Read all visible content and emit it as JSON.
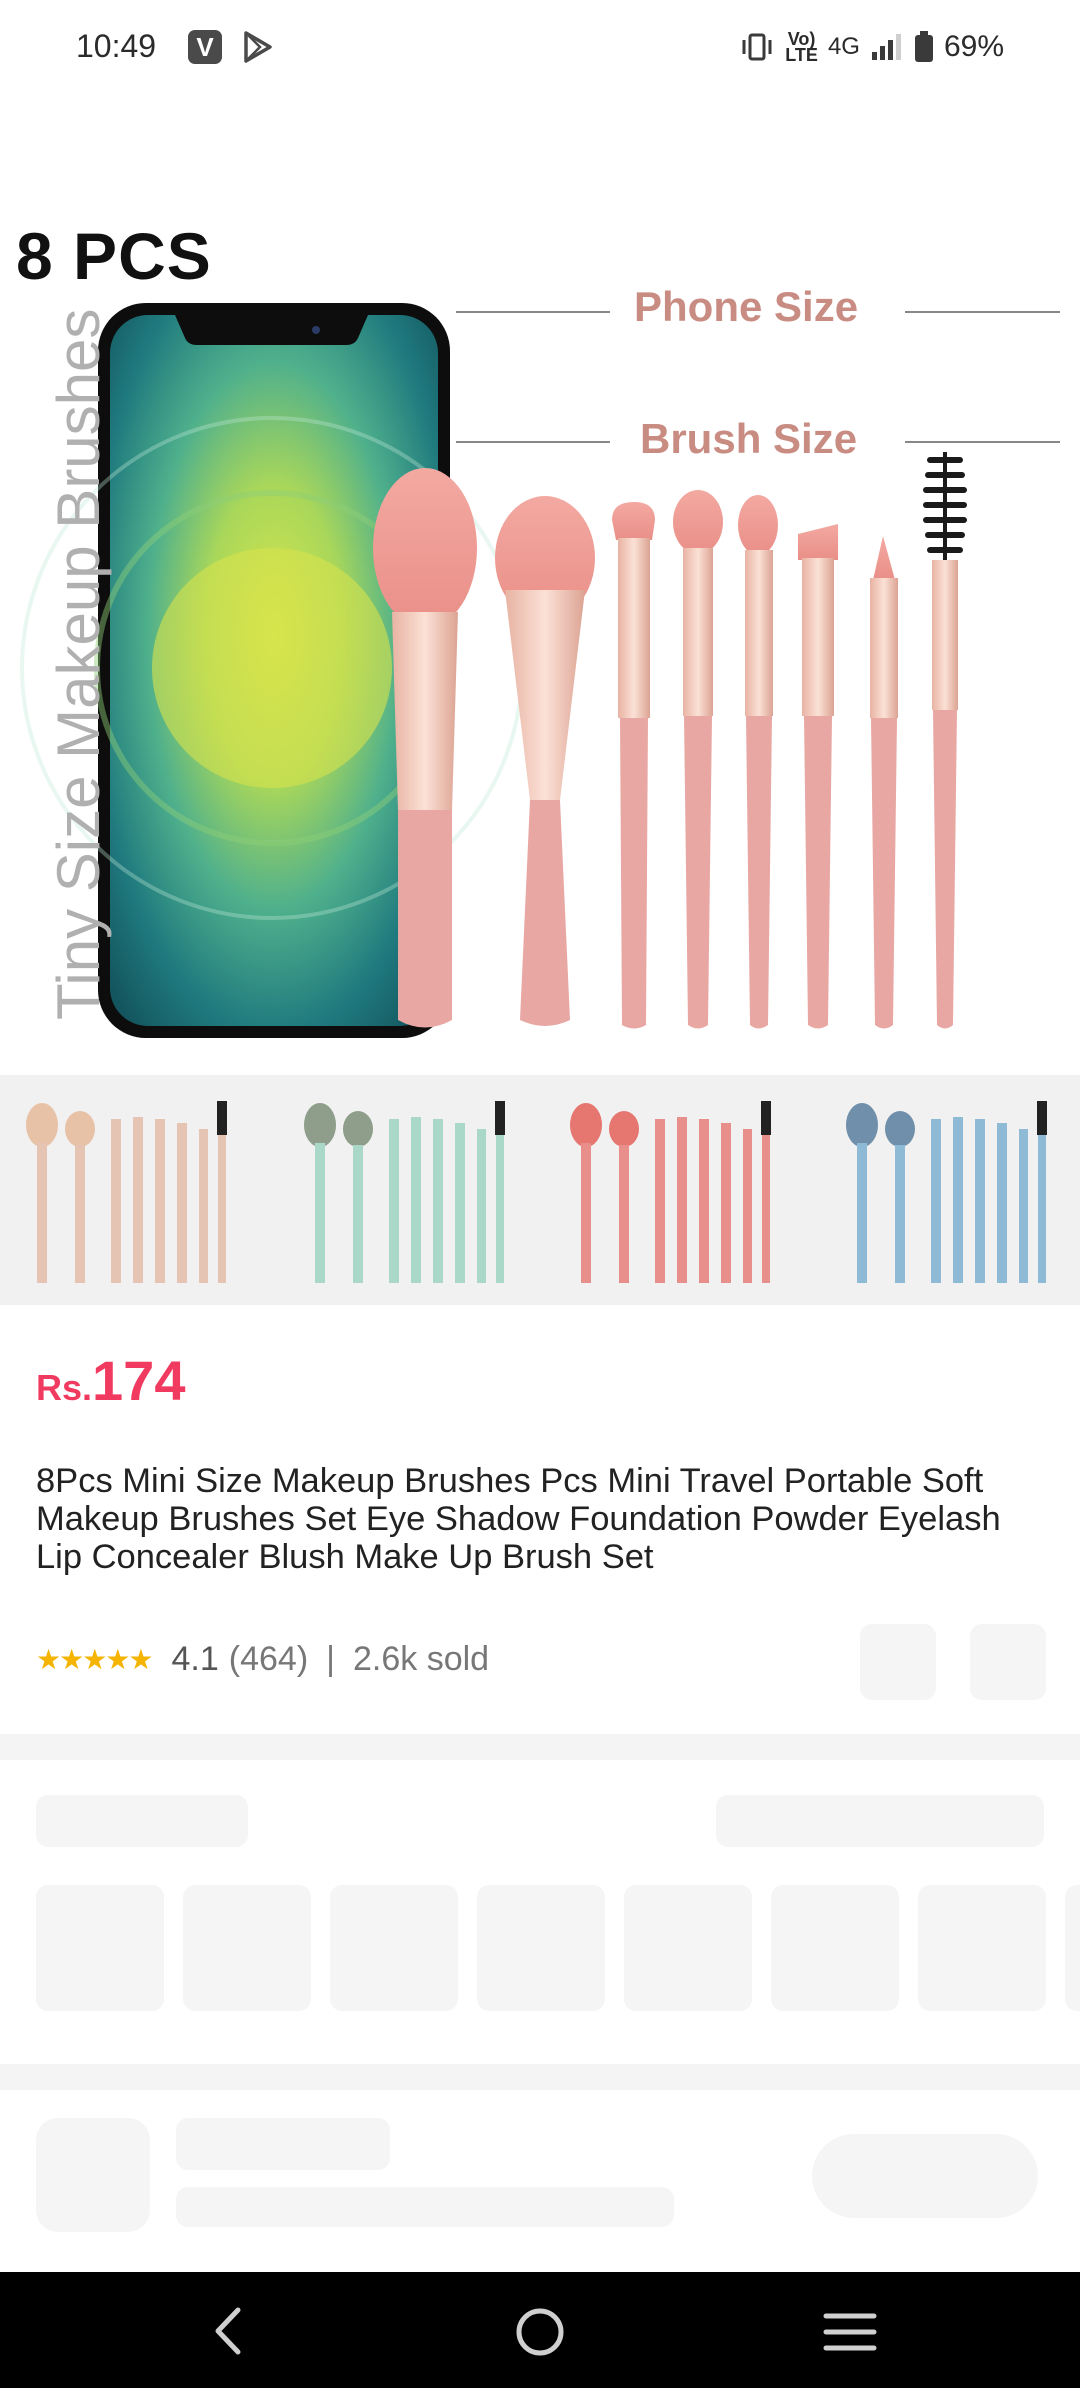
{
  "status_bar": {
    "time": "10:49",
    "v_badge": "V",
    "volte_top": "Vo)",
    "volte_bottom": "LTE",
    "network": "4G",
    "battery": "69%"
  },
  "hero": {
    "title": "8 PCS",
    "side_text": "Tiny Size Makeup Brushes",
    "phone_size_label": "Phone Size",
    "brush_size_label": "Brush Size"
  },
  "thumbnails": [
    {
      "name": "peach",
      "color": "#e8c2a6",
      "handle": "#e6c4b4"
    },
    {
      "name": "green",
      "color": "#8e9e8a",
      "handle": "#a9d7c8"
    },
    {
      "name": "red",
      "color": "#e57770",
      "handle": "#e88f8b"
    },
    {
      "name": "blue",
      "color": "#6f8faa",
      "handle": "#8fbad6"
    }
  ],
  "product": {
    "currency": "Rs.",
    "price": "174",
    "title": "8Pcs Mini Size Makeup Brushes Pcs Mini Travel Portable Soft Makeup Brushes Set Eye Shadow Foundation Powder Eyelash Lip Concealer Blush Make Up Brush Set",
    "stars": "★★★★★",
    "rating": "4.1",
    "reviews": "(464)",
    "separator": "|",
    "sold": "2.6k sold"
  },
  "colors": {
    "price": "#f03a5f",
    "skeleton": "#f5f5f5",
    "brush_pink": "#e8a7a3",
    "ferrule": "#efc3b4"
  }
}
